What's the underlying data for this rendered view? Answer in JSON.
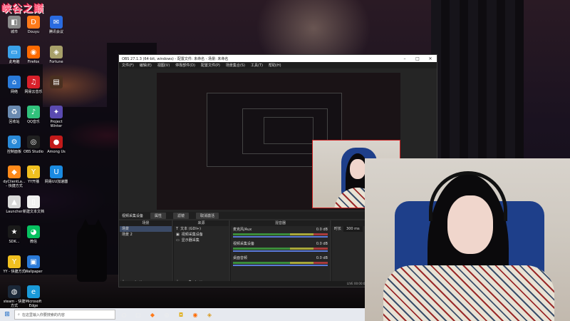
{
  "overlay": {
    "brand": "峡谷之巅"
  },
  "desktop": {
    "icons": [
      {
        "label": "城市",
        "glyph": "◧",
        "color": "#8a8a8a",
        "icon": "city-icon"
      },
      {
        "label": "Douyu",
        "glyph": "D",
        "color": "#ff7a1a",
        "icon": "douyu-icon"
      },
      {
        "label": "腾讯会议",
        "glyph": "✉",
        "color": "#2a6be0",
        "icon": "meeting-icon"
      },
      {
        "label": "此电脑",
        "glyph": "▭",
        "color": "#3aa0e8",
        "icon": "computer-icon"
      },
      {
        "label": "Firefox",
        "glyph": "◉",
        "color": "#ff6a00",
        "icon": "firefox-icon"
      },
      {
        "label": "Fortune",
        "glyph": "◈",
        "color": "#a8a06a",
        "icon": "fortune-icon"
      },
      {
        "label": "网络",
        "glyph": "⌂",
        "color": "#2a7ad8",
        "icon": "network-icon"
      },
      {
        "label": "网易云音乐",
        "glyph": "♫",
        "color": "#d8202a",
        "icon": "netease-music-icon"
      },
      {
        "label": "",
        "glyph": "▤",
        "color": "#4a3020",
        "icon": "app-icon"
      },
      {
        "label": "回收站",
        "glyph": "♻",
        "color": "#6a8ab0",
        "icon": "recycle-bin-icon"
      },
      {
        "label": "QQ音乐",
        "glyph": "♪",
        "color": "#31c27c",
        "icon": "qq-music-icon"
      },
      {
        "label": "Project Winter",
        "glyph": "✦",
        "color": "#5a4ab0",
        "icon": "project-winter-icon"
      },
      {
        "label": "控制面板",
        "glyph": "⚙",
        "color": "#2a8ad8",
        "icon": "control-panel-icon"
      },
      {
        "label": "OBS Studio",
        "glyph": "◎",
        "color": "#202020",
        "icon": "obs-icon"
      },
      {
        "label": "Among Us",
        "glyph": "●",
        "color": "#c21a1a",
        "icon": "among-us-icon"
      },
      {
        "label": "dyClientLa... - 快捷方式",
        "glyph": "◆",
        "color": "#ff8a1a",
        "icon": "dyclient-icon"
      },
      {
        "label": "YY开播",
        "glyph": "Y",
        "color": "#f0c020",
        "icon": "yy-live-icon"
      },
      {
        "label": "网易UU加速器",
        "glyph": "U",
        "color": "#1a8ae0",
        "icon": "uu-accelerator-icon"
      },
      {
        "label": "Launcher",
        "glyph": "▲",
        "color": "#d8d8d8",
        "icon": "launcher-icon"
      },
      {
        "label": "新建文本文档",
        "glyph": "▯",
        "color": "#f0f0f0",
        "icon": "text-document-icon"
      },
      {
        "label": "",
        "glyph": "",
        "color": "transparent",
        "icon": "blank-icon"
      },
      {
        "label": "SDK...",
        "glyph": "★",
        "color": "#1a1a1a",
        "icon": "sdk-icon"
      },
      {
        "label": "微信",
        "glyph": "◕",
        "color": "#07c160",
        "icon": "wechat-icon"
      },
      {
        "label": "",
        "glyph": "",
        "color": "transparent",
        "icon": "blank-icon"
      },
      {
        "label": "YY - 快捷方式",
        "glyph": "Y",
        "color": "#f0c020",
        "icon": "yy-icon"
      },
      {
        "label": "Wallpaper",
        "glyph": "▣",
        "color": "#2a7ad8",
        "icon": "wallpaper-icon"
      },
      {
        "label": "",
        "glyph": "",
        "color": "transparent",
        "icon": "blank-icon"
      },
      {
        "label": "steam - 快捷方式",
        "glyph": "◍",
        "color": "#1b2838",
        "icon": "steam-icon"
      },
      {
        "label": "Microsoft Edge",
        "glyph": "e",
        "color": "#1a9ad8",
        "icon": "edge-icon"
      }
    ]
  },
  "obs": {
    "title": "OBS 27.1.3 (64-bit, windows) - 配置文件: 未命名 - 场景: 未命名",
    "menu": [
      "文件(F)",
      "编辑(E)",
      "视图(V)",
      "停靠部件(D)",
      "配置文件(P)",
      "场景集合(S)",
      "工具(T)",
      "帮助(H)"
    ],
    "selection_bar": {
      "source": "视频采集设备",
      "properties": "属性",
      "filters": "滤镜",
      "device": "取消激活"
    },
    "scenes": {
      "header": "场景",
      "items": [
        "场景",
        "场景 2"
      ]
    },
    "sources": {
      "header": "来源",
      "items": [
        "文本 (GDI+)",
        "视频采集设备",
        "显示器采集"
      ]
    },
    "mixer": {
      "header": "混音器",
      "channels": [
        {
          "name": "麦克风/Aux",
          "db": "0.0 dB"
        },
        {
          "name": "视频采集设备",
          "db": "0.0 dB"
        },
        {
          "name": "桌面音频",
          "db": "0.0 dB"
        }
      ]
    },
    "transitions": {
      "header": "转场特效",
      "label_duration": "时长",
      "duration": "300 ms"
    },
    "status": {
      "live_label": "LIVE",
      "live_time": "00:00:00",
      "rec_label": "REC",
      "rec_time": "00:00:00",
      "cpu": "CPU"
    }
  },
  "taskbar": {
    "search_placeholder": "在这里输入你要搜索的内容"
  }
}
